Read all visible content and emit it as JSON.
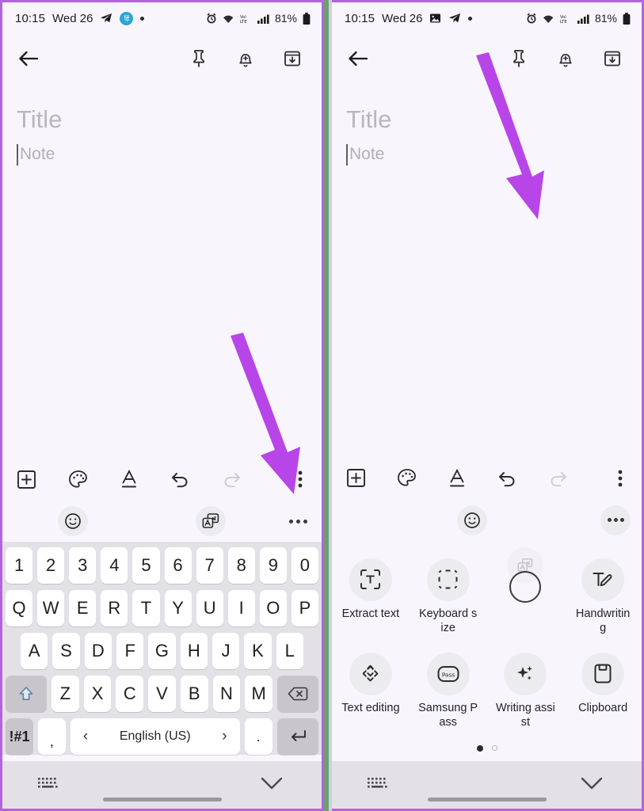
{
  "annotation": {
    "accent_color": "#b845e8",
    "frame_border_color": "#b463e0",
    "divider_green": "#6f9c72",
    "divider_blue": "#c8d4d9",
    "arrow_left_target": "more-options-ellipsis",
    "arrow_right_target": "translate-option-hidden"
  },
  "theme": {
    "background": "#f8f6fc",
    "keyboard_background": "#e3e1e6",
    "key_background": "#ffffff",
    "key_grey": "#c8c6cb",
    "chip_background": "#ececef",
    "text_primary": "#1f1f1f",
    "placeholder": "#b9b6bd",
    "badge_blue": "#2aa7d4"
  },
  "left_panel": {
    "status_bar": {
      "time": "10:15",
      "date": "Wed 26",
      "icons": [
        "telegram-icon",
        "hindi-badge",
        "dot-indicator"
      ],
      "badge_text": "हिं",
      "right_icons": [
        "alarm-icon",
        "wifi-icon",
        "volte-icon",
        "signal-icon"
      ],
      "battery_percent": "81%"
    },
    "app_bar": {
      "back": "back-arrow",
      "actions": [
        "pin-icon",
        "reminder-icon",
        "archive-icon"
      ]
    },
    "editor": {
      "title_placeholder": "Title",
      "note_placeholder": "Note"
    },
    "format_toolbar": {
      "items": [
        "insert-icon",
        "palette-icon",
        "text-format-icon",
        "undo-icon",
        "redo-icon"
      ],
      "overflow": "vertical-ellipsis"
    },
    "suggestion_bar": {
      "emoji": "emoji-icon",
      "translate": "translate-icon",
      "more": "horizontal-ellipsis"
    },
    "keyboard": {
      "row_numbers": [
        "1",
        "2",
        "3",
        "4",
        "5",
        "6",
        "7",
        "8",
        "9",
        "0"
      ],
      "row_top": [
        "Q",
        "W",
        "E",
        "R",
        "T",
        "Y",
        "U",
        "I",
        "O",
        "P"
      ],
      "row_mid": [
        "A",
        "S",
        "D",
        "F",
        "G",
        "H",
        "J",
        "K",
        "L"
      ],
      "row_bot": [
        "Z",
        "X",
        "C",
        "V",
        "B",
        "N",
        "M"
      ],
      "shift_key": "shift-icon",
      "backspace_key": "backspace-icon",
      "symbols_key": "!#1",
      "comma_key": ",",
      "period_key": ".",
      "space_label": "English (US)",
      "space_prev": "‹",
      "space_next": "›",
      "enter_key": "enter-icon"
    },
    "nav_bar": {
      "keyboard_icon": "keyboard-icon",
      "hide_icon": "chevron-down-icon"
    }
  },
  "right_panel": {
    "status_bar": {
      "time": "10:15",
      "date": "Wed 26",
      "icons": [
        "image-icon",
        "telegram-icon",
        "dot-indicator"
      ],
      "right_icons": [
        "alarm-icon",
        "wifi-icon",
        "volte-icon",
        "signal-icon"
      ],
      "battery_percent": "81%"
    },
    "app_bar": {
      "back": "back-arrow",
      "actions": [
        "pin-icon",
        "reminder-icon",
        "archive-icon"
      ]
    },
    "editor": {
      "title_placeholder": "Title",
      "note_placeholder": "Note"
    },
    "format_toolbar": {
      "items": [
        "insert-icon",
        "palette-icon",
        "text-format-icon",
        "undo-icon",
        "redo-icon"
      ],
      "overflow": "vertical-ellipsis"
    },
    "suggestion_bar": {
      "emoji": "emoji-icon",
      "more": "horizontal-ellipsis"
    },
    "options": {
      "row1": [
        {
          "label": "Extract text",
          "icon": "extract-text-icon"
        },
        {
          "label": "Keyboard size",
          "icon": "keyboard-size-icon"
        },
        {
          "label": "",
          "icon": "translate-icon-hidden"
        },
        {
          "label": "Handwriting",
          "icon": "handwriting-icon"
        }
      ],
      "row2": [
        {
          "label": "Text editing",
          "icon": "text-editing-icon"
        },
        {
          "label": "Samsung Pass",
          "icon": "samsung-pass-icon"
        },
        {
          "label": "Writing assist",
          "icon": "writing-assist-icon"
        },
        {
          "label": "Clipboard",
          "icon": "clipboard-icon"
        }
      ],
      "page_current": 1,
      "page_count": 2
    },
    "nav_bar": {
      "keyboard_icon": "keyboard-icon",
      "hide_icon": "chevron-down-icon"
    }
  }
}
